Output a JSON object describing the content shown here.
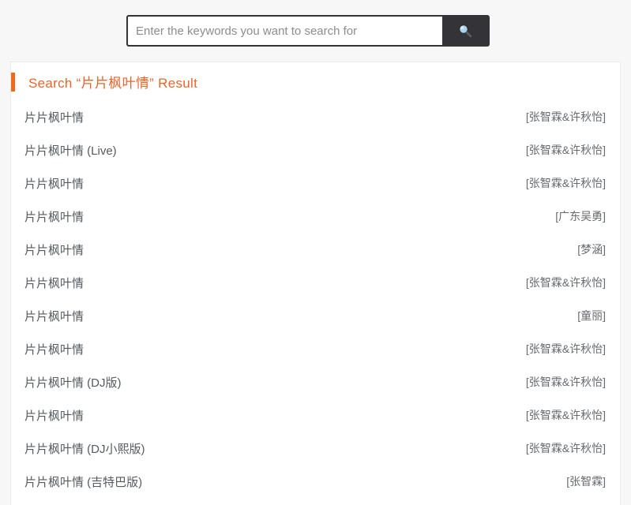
{
  "search": {
    "placeholder": "Enter the keywords you want to search for",
    "value": "",
    "button_icon": "search-icon"
  },
  "results": {
    "header_prefix": "Search",
    "header_query": "“片片枫叶情”",
    "header_suffix": "Result",
    "header_full": "Search “片片枫叶情” Result",
    "accent_color": "#f1691d",
    "items": [
      {
        "title": "片片枫叶情",
        "artist": "[张智霖&许秋怡]"
      },
      {
        "title": "片片枫叶情 (Live)",
        "artist": "[张智霖&许秋怡]"
      },
      {
        "title": "片片枫叶情",
        "artist": "[张智霖&许秋怡]"
      },
      {
        "title": "片片枫叶情",
        "artist": "[广东吴勇]"
      },
      {
        "title": "片片枫叶情",
        "artist": "[梦涵]"
      },
      {
        "title": "片片枫叶情",
        "artist": "[张智霖&许秋怡]"
      },
      {
        "title": "片片枫叶情",
        "artist": "[童丽]"
      },
      {
        "title": "片片枫叶情",
        "artist": "[张智霖&许秋怡]"
      },
      {
        "title": "片片枫叶情 (DJ版)",
        "artist": "[张智霖&许秋怡]"
      },
      {
        "title": "片片枫叶情",
        "artist": "[张智霖&许秋怡]"
      },
      {
        "title": "片片枫叶情 (DJ小熙版)",
        "artist": "[张智霖&许秋怡]"
      },
      {
        "title": "片片枫叶情 (吉特巴版)",
        "artist": "[张智霖]"
      }
    ]
  }
}
